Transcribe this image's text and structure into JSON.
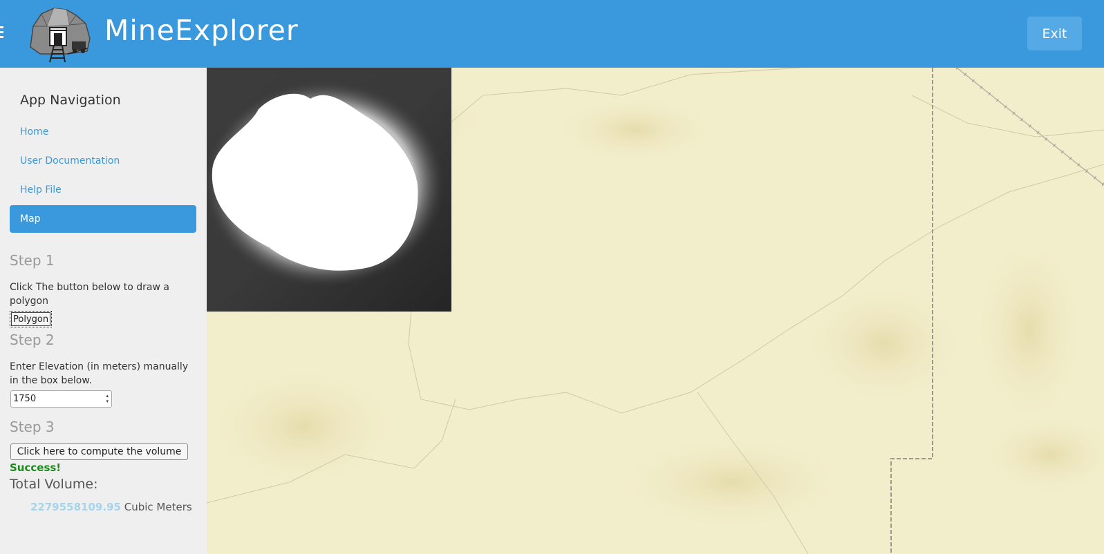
{
  "header": {
    "app_title": "MineExplorer",
    "exit_label": "Exit",
    "brand_color": "#3a99dc"
  },
  "sidebar": {
    "heading": "App Navigation",
    "items": [
      {
        "label": "Home",
        "active": false
      },
      {
        "label": "User Documentation",
        "active": false
      },
      {
        "label": "Help File",
        "active": false
      },
      {
        "label": "Map",
        "active": true
      }
    ]
  },
  "steps": {
    "step1": {
      "title": "Step 1",
      "description": "Click The button below to draw a polygon",
      "button_label": "Polygon"
    },
    "step2": {
      "title": "Step 2",
      "description": "Enter Elevation (in meters) manually in the box below.",
      "elevation_value": "1750"
    },
    "step3": {
      "title": "Step 3",
      "button_label": "Click here to compute the volume",
      "status": "Success!"
    }
  },
  "result": {
    "label": "Total Volume:",
    "value": "2279558109.95",
    "unit": "Cubic Meters"
  },
  "icons": {
    "menu": "hamburger-icon",
    "logo": "mine-entrance-logo"
  },
  "colors": {
    "success": "#1a8a1a",
    "map_background": "#f2edcb",
    "volume_value": "#a6d4ea"
  }
}
